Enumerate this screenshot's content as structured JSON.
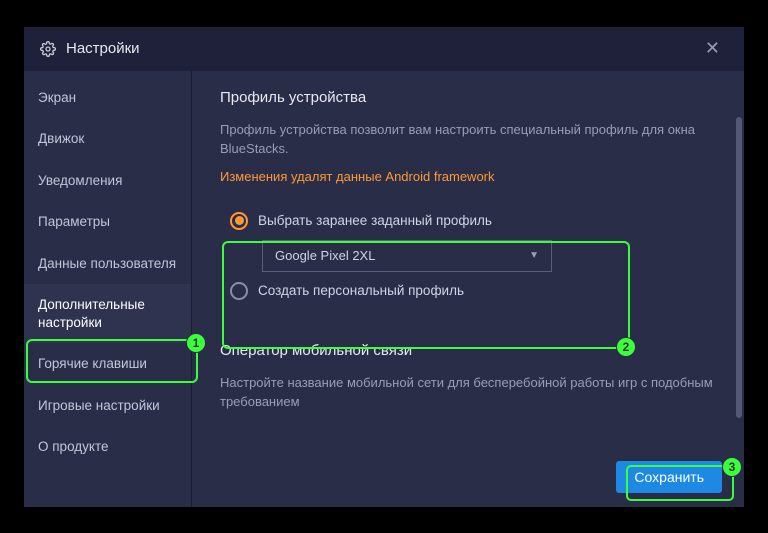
{
  "titlebar": {
    "title": "Настройки"
  },
  "sidebar": {
    "items": [
      {
        "label": "Экран"
      },
      {
        "label": "Движок"
      },
      {
        "label": "Уведомления"
      },
      {
        "label": "Параметры"
      },
      {
        "label": "Данные пользователя"
      },
      {
        "label": "Дополнительные настройки"
      },
      {
        "label": "Горячие клавиши"
      },
      {
        "label": "Игровые настройки"
      },
      {
        "label": "О продукте"
      }
    ],
    "active_index": 5
  },
  "content": {
    "profile": {
      "title": "Профиль устройства",
      "desc": "Профиль устройства позволит вам настроить специальный профиль для окна BlueStacks.",
      "warning": "Изменения удалят данные Android framework",
      "radio_preset": "Выбрать заранее заданный профиль",
      "preset_value": "Google Pixel 2XL",
      "radio_custom": "Создать персональный профиль",
      "selected": "preset"
    },
    "carrier": {
      "title": "Оператор мобильной связи",
      "desc": "Настройте название мобильной сети для бесперебойной работы игр с подобным требованием"
    }
  },
  "footer": {
    "save_label": "Сохранить"
  },
  "annotations": {
    "n1": "1",
    "n2": "2",
    "n3": "3"
  }
}
